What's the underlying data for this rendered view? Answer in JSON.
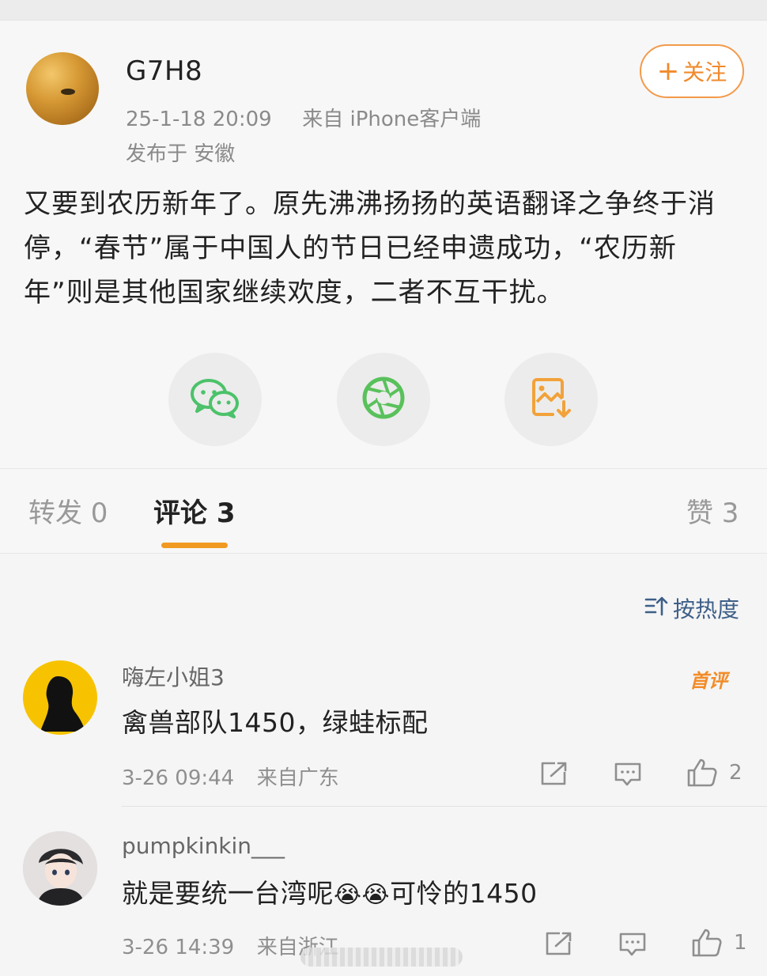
{
  "post": {
    "username": "G7H8",
    "time": "25-1-18 20:09",
    "source": "来自 iPhone客户端",
    "location": "发布于 安徽",
    "follow_label": "关注",
    "content": "又要到农历新年了。原先沸沸扬扬的英语翻译之争终于消停，“春节”属于中国人的节日已经申遗成功，“农历新年”则是其他国家继续欢度，二者不互干扰。",
    "share_icons": [
      "wechat-icon",
      "moments-icon",
      "save-image-icon"
    ],
    "colors": {
      "accent": "#f08a2c",
      "wechat": "#4cc26a",
      "moments": "#59c15b",
      "save": "#f2a23a"
    }
  },
  "tabs": {
    "repost": "转发 0",
    "comments": "评论 3",
    "likes": "赞 3"
  },
  "comments": {
    "sort_label": "按热度",
    "items": [
      {
        "name": "嗨左小姐3",
        "badge": "首评",
        "text": "禽兽部队1450，绿蛙标配",
        "time": "3-26 09:44",
        "location": "来自广东",
        "likes": "2"
      },
      {
        "name": "pumpkinkin___",
        "text_before": "就是要统一台湾呢",
        "emoji": "😭😭",
        "text_after": "可怜的1450",
        "time": "3-26 14:39",
        "location": "来自浙江",
        "likes": "1"
      }
    ]
  }
}
